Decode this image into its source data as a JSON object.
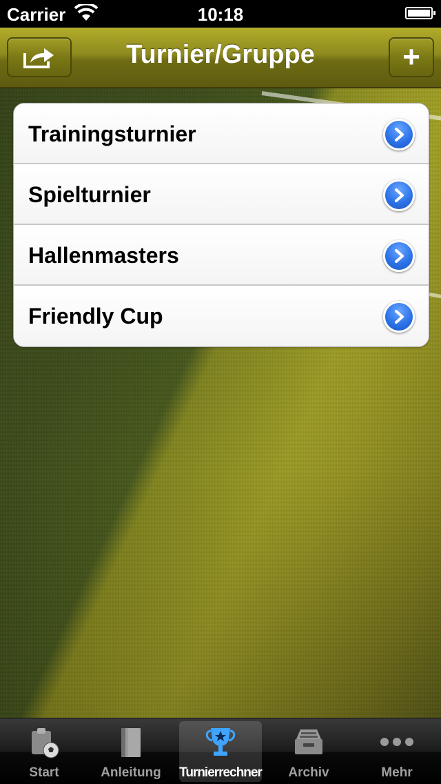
{
  "status_bar": {
    "carrier": "Carrier",
    "time": "10:18"
  },
  "nav": {
    "title": "Turnier/Gruppe",
    "share_icon": "share-icon",
    "add_label": "+"
  },
  "list": {
    "items": [
      {
        "label": "Trainingsturnier"
      },
      {
        "label": "Spielturnier"
      },
      {
        "label": "Hallenmasters"
      },
      {
        "label": "Friendly Cup"
      }
    ]
  },
  "tabs": {
    "items": [
      {
        "label": "Start",
        "icon": "clipboard-ball-icon"
      },
      {
        "label": "Anleitung",
        "icon": "book-icon"
      },
      {
        "label": "Turnierrechner",
        "icon": "trophy-icon",
        "selected": true
      },
      {
        "label": "Archiv",
        "icon": "archive-tray-icon"
      },
      {
        "label": "Mehr",
        "icon": "more-dots-icon"
      }
    ]
  },
  "colors": {
    "nav_bar": "#8e8a1e",
    "disclosure": "#2d74e8",
    "tab_active": "#ffffff",
    "tab_inactive": "#a0a0a0"
  }
}
